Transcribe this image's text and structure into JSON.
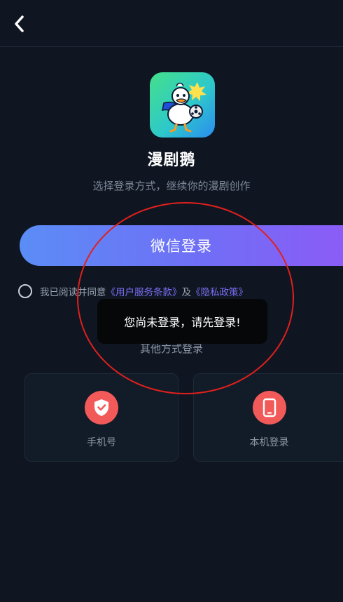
{
  "header": {
    "back_icon": "chevron-left-icon"
  },
  "app": {
    "name": "漫剧鹅",
    "subtitle": "选择登录方式，继续你的漫剧创作",
    "logo_icon": "duck-mascot-logo"
  },
  "login": {
    "wechat_label": "微信登录"
  },
  "agreement": {
    "prefix": "我已阅读并同意",
    "terms_link": "《用户服务条款》",
    "conjunction": "及",
    "privacy_link": "《隐私政策》",
    "checked": false
  },
  "other_methods": {
    "title": "其他方式登录",
    "items": [
      {
        "label": "手机号",
        "icon": "shield-check-icon"
      },
      {
        "label": "本机登录",
        "icon": "smartphone-icon"
      }
    ]
  },
  "toast": {
    "message": "您尚未登录，请先登录!"
  },
  "colors": {
    "background": "#0f1622",
    "button_gradient_start": "#5b8df6",
    "button_gradient_end": "#8b5cf6",
    "link": "#7d6cf0",
    "method_icon_bg": "#f25a5a",
    "annotation": "#e0201c"
  }
}
